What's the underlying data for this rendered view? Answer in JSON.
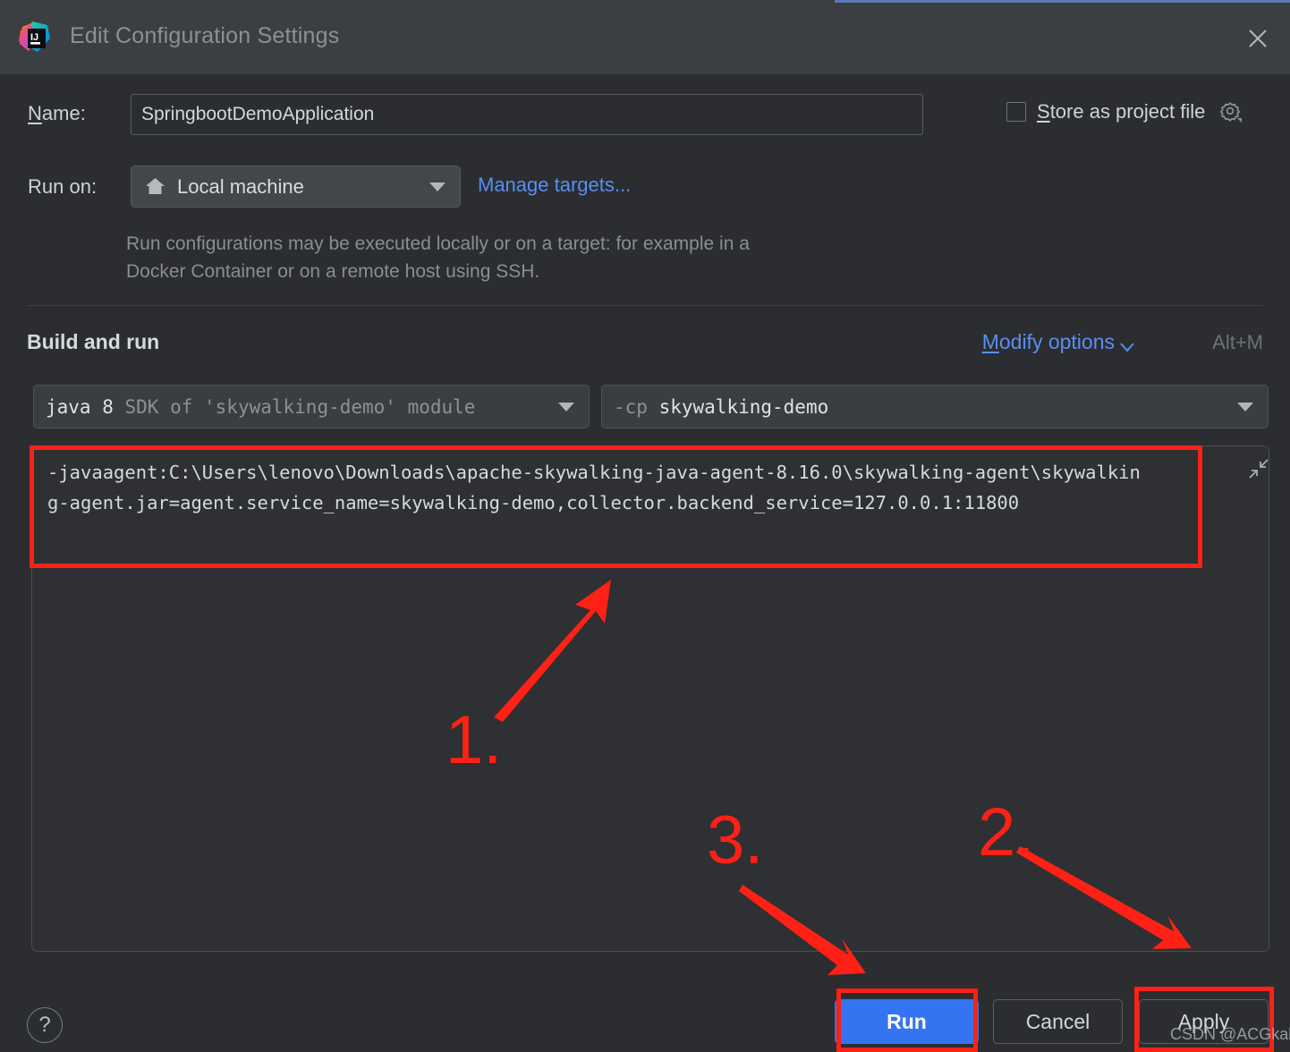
{
  "window": {
    "title": "Edit Configuration Settings",
    "logo_icon": "intellij-idea-logo",
    "close_icon": "close-icon"
  },
  "form": {
    "name_label": "Name:",
    "name_label_mnemonic": "N",
    "name_value": "SpringbootDemoApplication",
    "store_as_project_file_label": "Store as project file",
    "store_as_project_file_mnemonic": "S",
    "store_as_project_file_checked": false,
    "gear_icon": "gear-icon",
    "run_on_label": "Run on:",
    "run_on_value": "Local machine",
    "run_on_icon": "home-icon",
    "manage_targets_link": "Manage targets...",
    "run_on_hint": "Run configurations may be executed locally or on a target: for example in a Docker Container or on a remote host using SSH."
  },
  "build_and_run": {
    "section_title": "Build and run",
    "modify_options_label": "Modify options",
    "modify_options_mnemonic": "M",
    "modify_options_shortcut": "Alt+M",
    "chevron_icon": "chevron-down-icon",
    "jdk_combo": {
      "primary": "java 8",
      "secondary": "SDK of 'skywalking-demo' module"
    },
    "classpath_combo": {
      "flag": "-cp",
      "value": "skywalking-demo"
    },
    "vm_options": "-javaagent:C:\\Users\\lenovo\\Downloads\\apache-skywalking-java-agent-8.16.0\\skywalking-agent\\skywalking-agent.jar=agent.service_name=skywalking-demo,collector.backend_service=127.0.0.1:11800",
    "expand_icon": "collapse-arrows-icon"
  },
  "footer": {
    "help_icon": "help-question-icon",
    "run_label": "Run",
    "cancel_label": "Cancel",
    "apply_label": "Apply"
  },
  "annotations": {
    "step_1": "1.",
    "step_2": "2.",
    "step_3": "3.",
    "highlight_color": "#ff2116"
  },
  "watermark": "CSDN @ACGkaka",
  "colors": {
    "titlebar_bg": "#3c3f41",
    "dialog_bg": "#2b2d30",
    "accent_blue": "#5a8ef0",
    "run_button_blue": "#3574f0",
    "annotation_red": "#ff2116",
    "title_accent_line": "#5a7ab8"
  }
}
